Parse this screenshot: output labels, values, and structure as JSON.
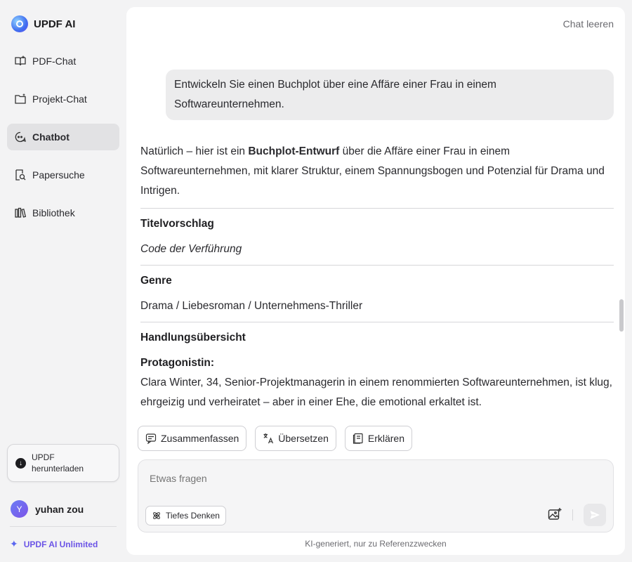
{
  "sidebar": {
    "brand": "UPDF AI",
    "items": [
      {
        "label": "PDF-Chat",
        "icon": "book-open-icon"
      },
      {
        "label": "Projekt-Chat",
        "icon": "folder-plus-icon"
      },
      {
        "label": "Chatbot",
        "icon": "chatbot-icon"
      },
      {
        "label": "Papersuche",
        "icon": "document-search-icon"
      },
      {
        "label": "Bibliothek",
        "icon": "library-icon"
      }
    ],
    "download_label": "UPDF herunterladen",
    "user": {
      "initial": "Y",
      "name": "yuhan zou"
    },
    "plan_label": "UPDF AI Unlimited"
  },
  "header": {
    "clear_chat": "Chat leeren"
  },
  "conversation": {
    "user_message": "Entwickeln Sie einen Buchplot über eine Affäre einer Frau in einem Softwareunternehmen.",
    "intro_before": "Natürlich – hier ist ein ",
    "intro_bold": "Buchplot-Entwurf",
    "intro_after": " über die Affäre einer Frau in einem Softwareunternehmen, mit klarer Struktur, einem Spannungsbogen und Potenzial für Drama und Intrigen.",
    "title_heading": "Titelvorschlag",
    "title_value": "Code der Verführung",
    "genre_heading": "Genre",
    "genre_value": "Drama / Liebesroman / Unternehmens-Thriller",
    "overview_heading": "Handlungsübersicht",
    "protagonist_heading": "Protagonistin:",
    "protagonist_text": "Clara Winter, 34, Senior-Projektmanagerin in einem renommierten Softwareunternehmen, ist klug, ehrgeizig und verheiratet – aber in einer Ehe, die emotional erkaltet ist."
  },
  "actions": {
    "summarize": "Zusammenfassen",
    "translate": "Übersetzen",
    "explain": "Erklären"
  },
  "composer": {
    "placeholder": "Etwas fragen",
    "deep_thinking": "Tiefes Denken"
  },
  "footer_note": "KI-generiert, nur zu Referenzzwecken"
}
